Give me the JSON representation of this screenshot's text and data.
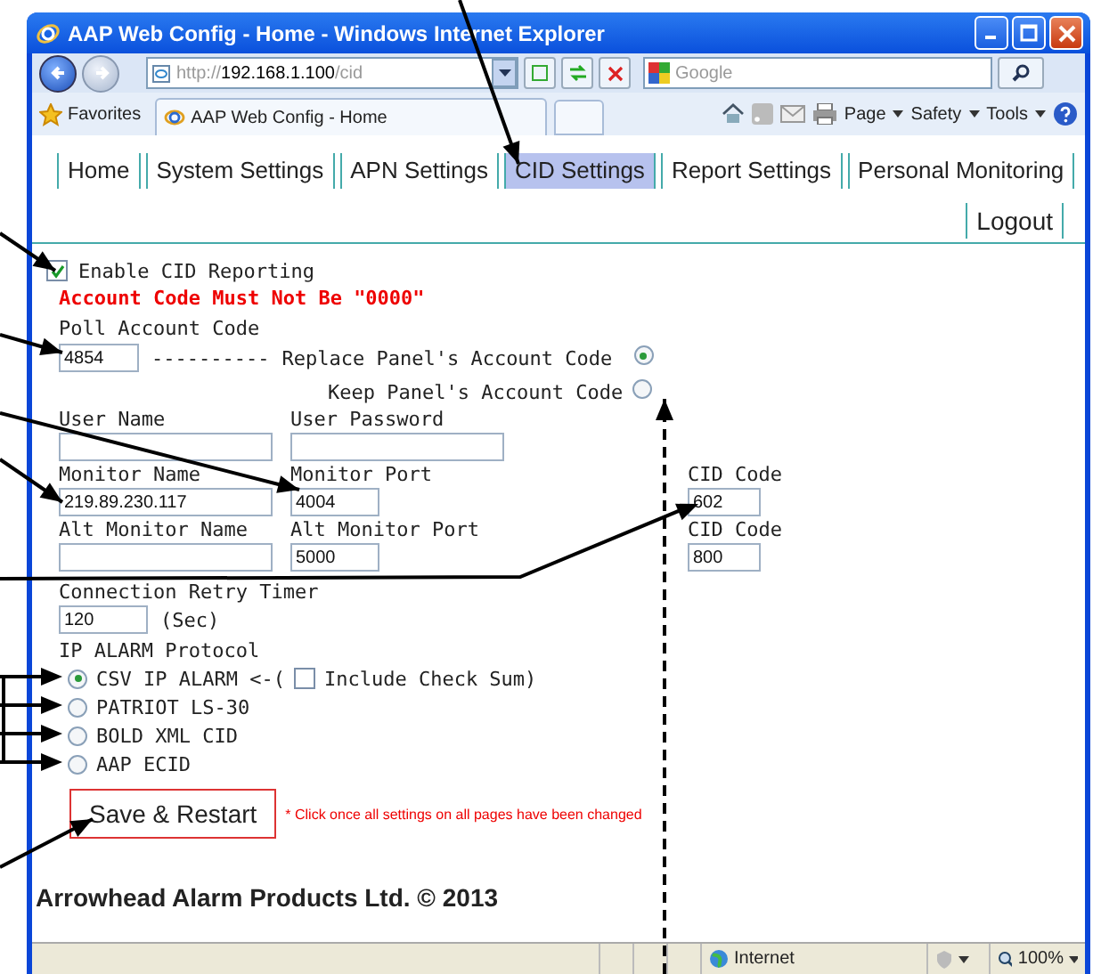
{
  "window": {
    "title": "AAP Web Config - Home - Windows Internet Explorer"
  },
  "address_bar": {
    "scheme": "http://",
    "host": "192.168.1.100",
    "path": "/cid"
  },
  "search": {
    "placeholder": "Google"
  },
  "favorites": {
    "label": "Favorites"
  },
  "browser_tab": {
    "title": "AAP Web Config - Home"
  },
  "command_bar": [
    "Page",
    "Safety",
    "Tools"
  ],
  "nav": {
    "tabs": [
      {
        "label": "Home",
        "selected": false
      },
      {
        "label": "System Settings",
        "selected": false
      },
      {
        "label": "APN Settings",
        "selected": false
      },
      {
        "label": "CID Settings",
        "selected": true
      },
      {
        "label": "Report Settings",
        "selected": false
      },
      {
        "label": "Personal Monitoring",
        "selected": false
      }
    ],
    "logout": "Logout"
  },
  "form": {
    "enable": {
      "label": "Enable CID Reporting",
      "checked": true
    },
    "warning": "Account Code Must Not Be \"0000\"",
    "poll": {
      "label": "Poll Account Code",
      "value": "4854",
      "dashes": "----------"
    },
    "account_options": [
      {
        "label": "Replace Panel's Account Code",
        "selected": true
      },
      {
        "label": "Keep Panel's Account Code",
        "selected": false
      }
    ],
    "field_rows": [
      [
        {
          "label": "User Name",
          "kind": "long"
        },
        {
          "label": "User Password",
          "kind": "long"
        }
      ],
      [
        {
          "label": "Monitor Name",
          "value": "219.89.230.117",
          "kind": "long"
        },
        {
          "label": "Monitor Port",
          "value": "4004",
          "kind": "short"
        },
        {
          "label": "CID Code",
          "value": "602",
          "kind": "tiny"
        }
      ],
      [
        {
          "label": "Alt Monitor Name",
          "kind": "long"
        },
        {
          "label": "Alt Monitor Port",
          "value": "5000",
          "kind": "short"
        },
        {
          "label": "CID Code",
          "value": "800",
          "kind": "tiny"
        }
      ]
    ],
    "retry": {
      "label": "Connection Retry Timer",
      "value": "120",
      "unit": "(Sec)"
    },
    "protocol": {
      "label": "IP ALARM Protocol",
      "options": [
        {
          "label": "CSV IP ALARM <-(",
          "selected": true,
          "checksum": {
            "label": "Include Check Sum)",
            "checked": false
          }
        },
        {
          "label": "PATRIOT LS-30",
          "selected": false
        },
        {
          "label": "BOLD XML CID",
          "selected": false
        },
        {
          "label": "AAP ECID",
          "selected": false
        }
      ]
    },
    "save_button": "Save & Restart",
    "save_note": "* Click once all settings on all pages have been changed",
    "footer": "Arrowhead Alarm Products Ltd. © 2013"
  },
  "status_bar": {
    "zone": "Internet",
    "zoom": "100%"
  }
}
